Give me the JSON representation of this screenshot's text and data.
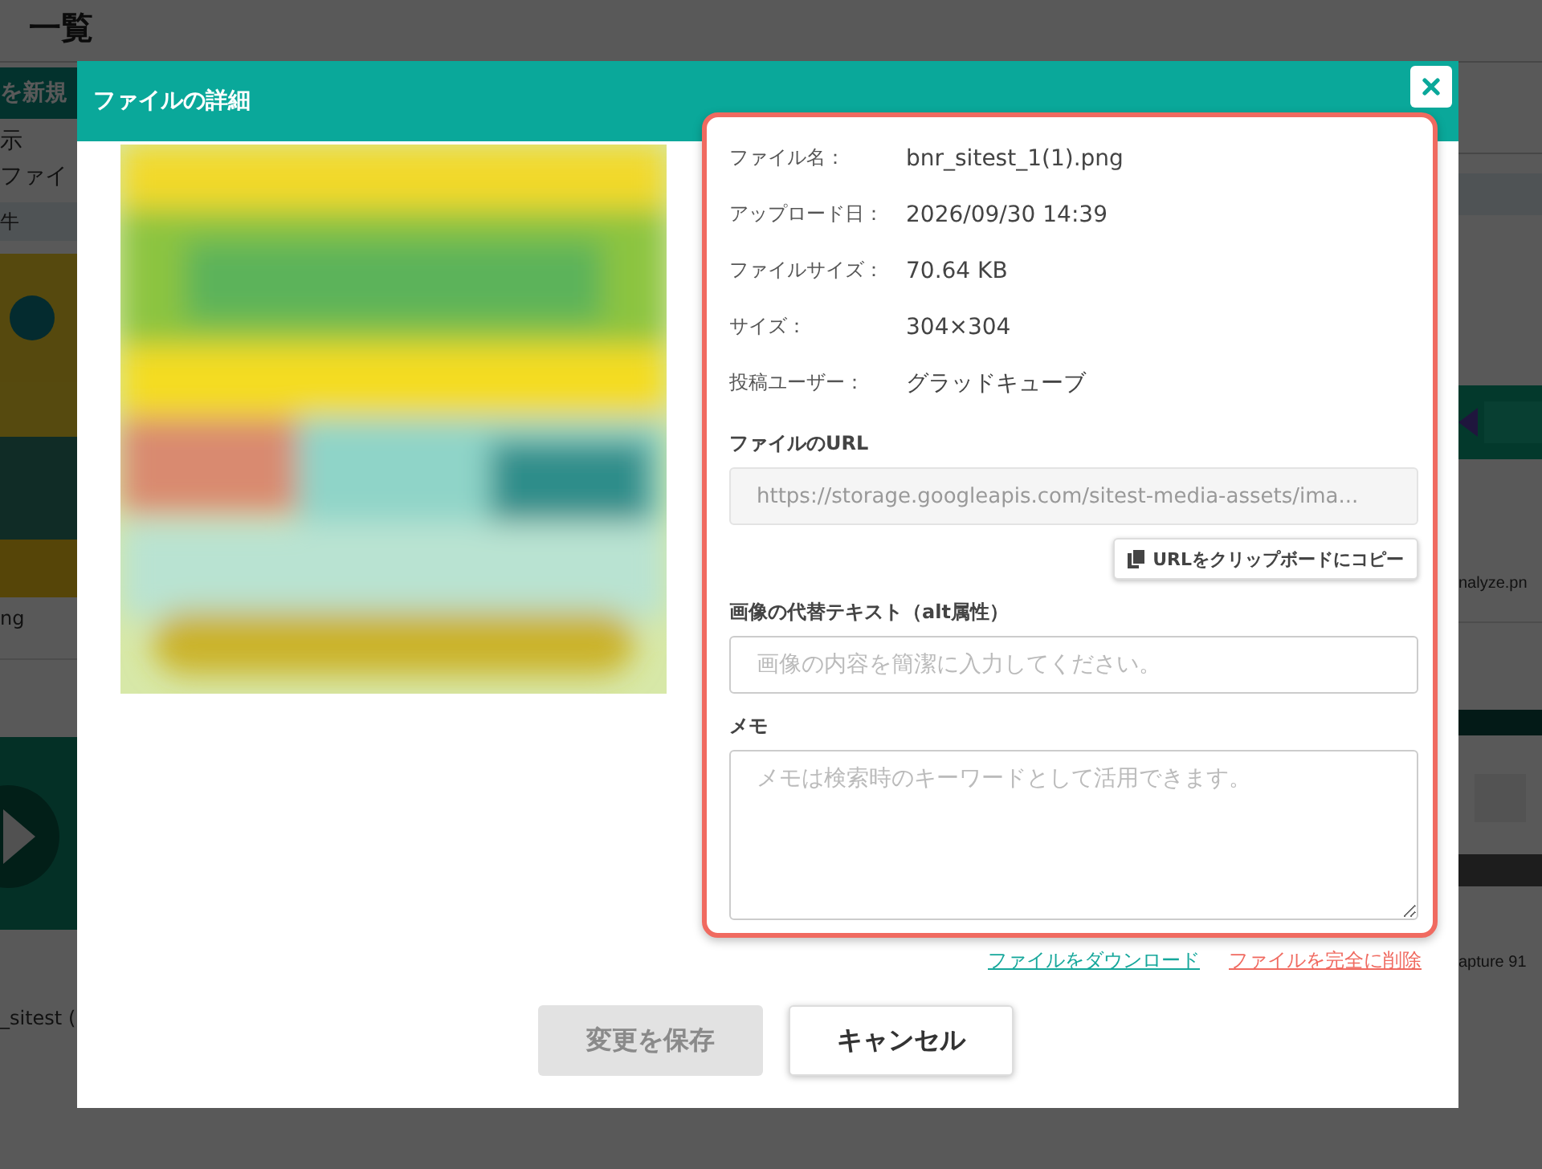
{
  "background_page": {
    "heading": "一覧",
    "left_column": {
      "new_button": "を新規",
      "texts": [
        "示",
        "ファイ"
      ],
      "table_header": "牛",
      "captions": [
        "ng",
        "_sitest ("
      ]
    },
    "right_column": {
      "captions": [
        "nalyze.pn",
        "apture 91"
      ]
    }
  },
  "modal": {
    "title": "ファイルの詳細",
    "details": [
      {
        "label": "ファイル名：",
        "value": "bnr_sitest_1(1).png"
      },
      {
        "label": "アップロード日：",
        "value": "2026/09/30 14:39"
      },
      {
        "label": "ファイルサイズ：",
        "value": "70.64 KB"
      },
      {
        "label": "サイズ：",
        "value": "304×304"
      },
      {
        "label": "投稿ユーザー：",
        "value": "グラッドキューブ"
      }
    ],
    "url_field": {
      "label": "ファイルのURL",
      "value": "https://storage.googleapis.com/sitest-media-assets/ima...",
      "disabled": true
    },
    "copy_button": "URLをクリップボードにコピー",
    "alt_field": {
      "label": "画像の代替テキスト（alt属性）",
      "placeholder": "画像の内容を簡潔に入力してください。"
    },
    "memo_field": {
      "label": "メモ",
      "placeholder": "メモは検索時のキーワードとして活用できます。"
    },
    "links": [
      {
        "label": "ファイルをダウンロード",
        "kind": "download"
      },
      {
        "label": "ファイルを完全に削除",
        "kind": "delete"
      }
    ],
    "buttons": [
      {
        "label": "変更を保存",
        "disabled": true
      },
      {
        "label": "キャンセル",
        "disabled": false
      }
    ]
  }
}
